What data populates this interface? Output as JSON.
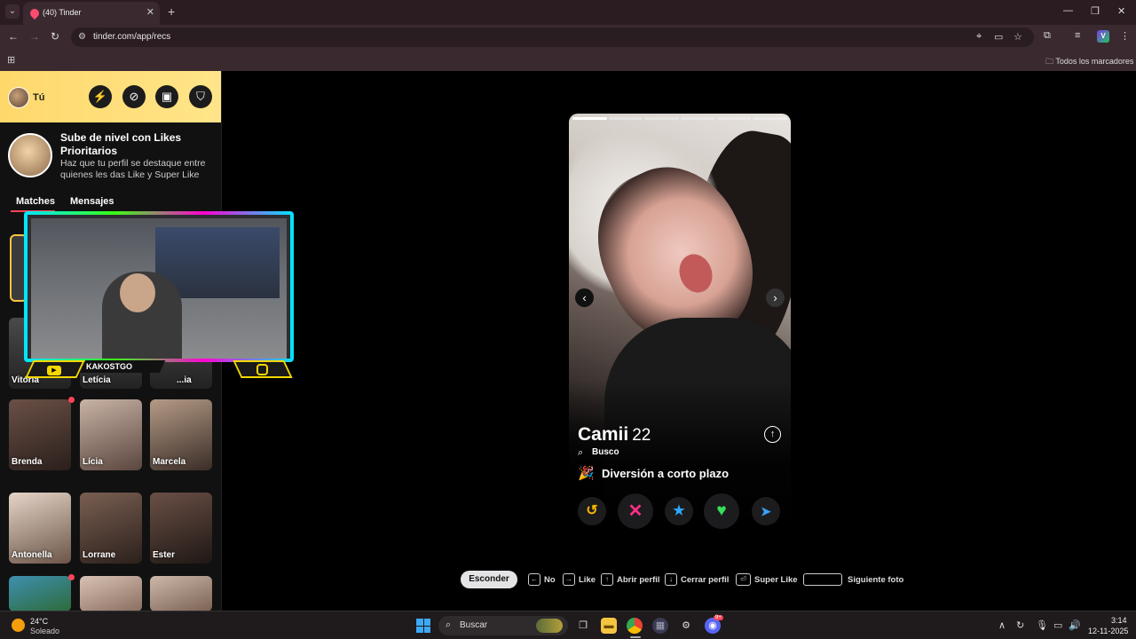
{
  "browser": {
    "tab_title": "(40) Tinder",
    "url": "tinder.com/app/recs",
    "bookmarks_folder": "Todos los marcadores"
  },
  "sidebar": {
    "user_label": "Tú",
    "promo": {
      "title": "Sube de nivel con Likes Prioritarios",
      "subtitle": "Haz que tu perfil se destaque entre quienes les das Like y Super Like"
    },
    "tabs": [
      "Matches",
      "Mensajes"
    ],
    "matches_row2": [
      "Vitória",
      "Letícia",
      "...ia"
    ],
    "matches_row3": [
      "Brenda",
      "Lícia",
      "Marcela"
    ],
    "matches_row4": [
      "Antonella",
      "Lorrane",
      "Ester"
    ]
  },
  "stream_overlay": {
    "streamer_name": "KAKOSTGO"
  },
  "profile": {
    "name": "Camii",
    "age": "22",
    "seeking_label": "Busco",
    "intent": "Diversión a corto plazo"
  },
  "hints": {
    "hide": "Esconder",
    "no": "No",
    "like": "Like",
    "open_profile": "Abrir perfil",
    "close_profile": "Cerrar perfil",
    "super_like": "Super Like",
    "next_photo": "Siguiente foto"
  },
  "taskbar": {
    "temperature": "24°C",
    "condition": "Soleado",
    "search_placeholder": "Buscar",
    "time": "3:14",
    "date": "12-11-2025",
    "discord_badge": "9+"
  },
  "colors": {
    "tinder_red": "#ff4458",
    "rewind": "#f7b500",
    "nope": "#ff2e88",
    "super_like": "#2ea8ff",
    "like": "#37e05a",
    "boost": "#3aa0ff"
  }
}
